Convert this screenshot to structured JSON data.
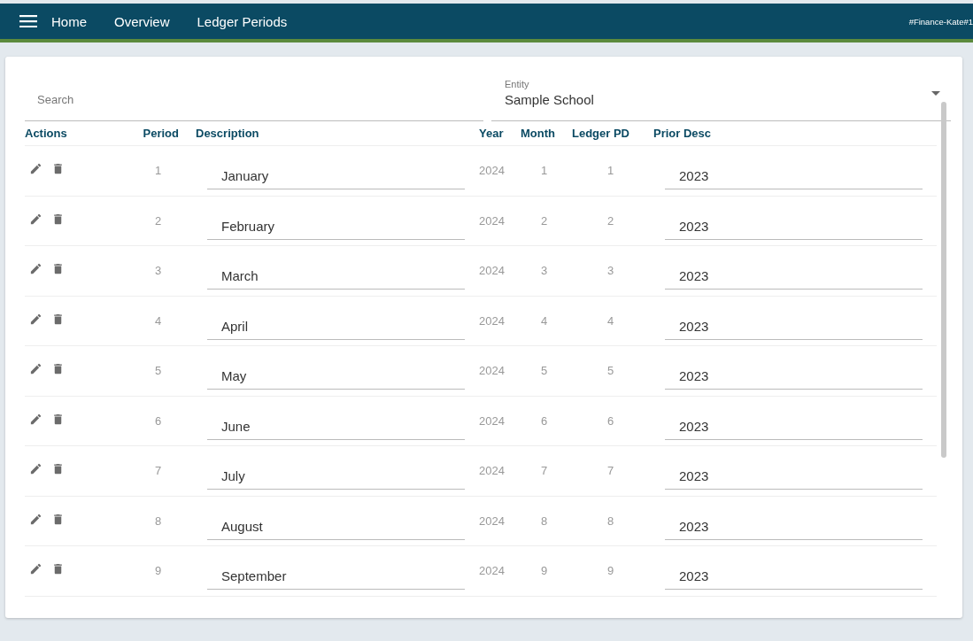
{
  "top_bar": {
    "nav": [
      "Home",
      "Overview",
      "Ledger Periods"
    ],
    "user_tag": "#Finance-Kate#1"
  },
  "search": {
    "placeholder": "Search"
  },
  "entity": {
    "label": "Entity",
    "value": "Sample School"
  },
  "table": {
    "columns": [
      "Actions",
      "Period",
      "Description",
      "Year",
      "Month",
      "Ledger PD",
      "Prior Desc"
    ],
    "rows": [
      {
        "period": "1",
        "description": "January",
        "year": "2024",
        "month": "1",
        "ledger_pd": "1",
        "prior_desc": "2023"
      },
      {
        "period": "2",
        "description": "February",
        "year": "2024",
        "month": "2",
        "ledger_pd": "2",
        "prior_desc": "2023"
      },
      {
        "period": "3",
        "description": "March",
        "year": "2024",
        "month": "3",
        "ledger_pd": "3",
        "prior_desc": "2023"
      },
      {
        "period": "4",
        "description": "April",
        "year": "2024",
        "month": "4",
        "ledger_pd": "4",
        "prior_desc": "2023"
      },
      {
        "period": "5",
        "description": "May",
        "year": "2024",
        "month": "5",
        "ledger_pd": "5",
        "prior_desc": "2023"
      },
      {
        "period": "6",
        "description": "June",
        "year": "2024",
        "month": "6",
        "ledger_pd": "6",
        "prior_desc": "2023"
      },
      {
        "period": "7",
        "description": "July",
        "year": "2024",
        "month": "7",
        "ledger_pd": "7",
        "prior_desc": "2023"
      },
      {
        "period": "8",
        "description": "August",
        "year": "2024",
        "month": "8",
        "ledger_pd": "8",
        "prior_desc": "2023"
      },
      {
        "period": "9",
        "description": "September",
        "year": "2024",
        "month": "9",
        "ledger_pd": "9",
        "prior_desc": "2023"
      }
    ]
  }
}
